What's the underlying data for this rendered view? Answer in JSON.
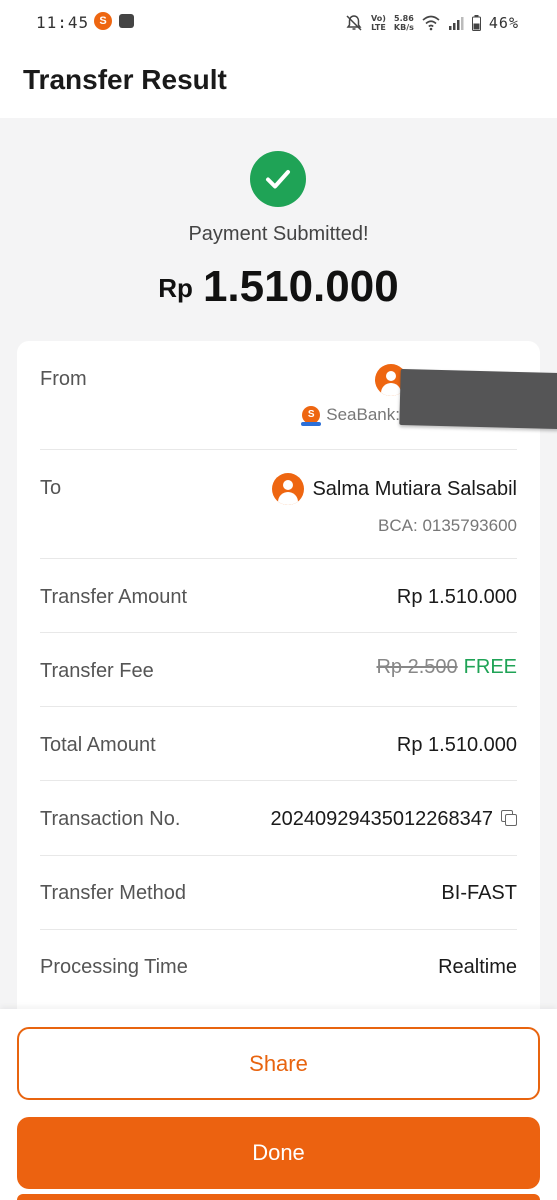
{
  "status_bar": {
    "time": "11:45",
    "app_icon_letter": "S",
    "network_top": "Vo)",
    "network_bottom": "LTE",
    "speed_top": "5.86",
    "speed_bottom": "KB/s",
    "battery": "46%"
  },
  "header": {
    "title": "Transfer Result"
  },
  "result": {
    "message": "Payment Submitted!",
    "currency": "Rp",
    "amount": "1.510.000"
  },
  "details": {
    "from": {
      "label": "From",
      "bank_logo_letter": "S",
      "bank": "SeaBank:"
    },
    "to": {
      "label": "To",
      "name": "Salma Mutiara Salsabil",
      "bank": "BCA: 0135793600"
    },
    "transfer_amount": {
      "label": "Transfer Amount",
      "value": "Rp 1.510.000"
    },
    "transfer_fee": {
      "label": "Transfer Fee",
      "old_value": "Rp 2.500",
      "value": "FREE"
    },
    "total_amount": {
      "label": "Total Amount",
      "value": "Rp 1.510.000"
    },
    "transaction_no": {
      "label": "Transaction No.",
      "value": "20240929435012268347"
    },
    "transfer_method": {
      "label": "Transfer Method",
      "value": "BI-FAST"
    },
    "processing_time": {
      "label": "Processing Time",
      "value": "Realtime"
    }
  },
  "actions": {
    "share_label": "Share",
    "done_label": "Done"
  },
  "colors": {
    "accent": "#EC6210",
    "success": "#1FA356",
    "background": "#F4F4F5"
  }
}
